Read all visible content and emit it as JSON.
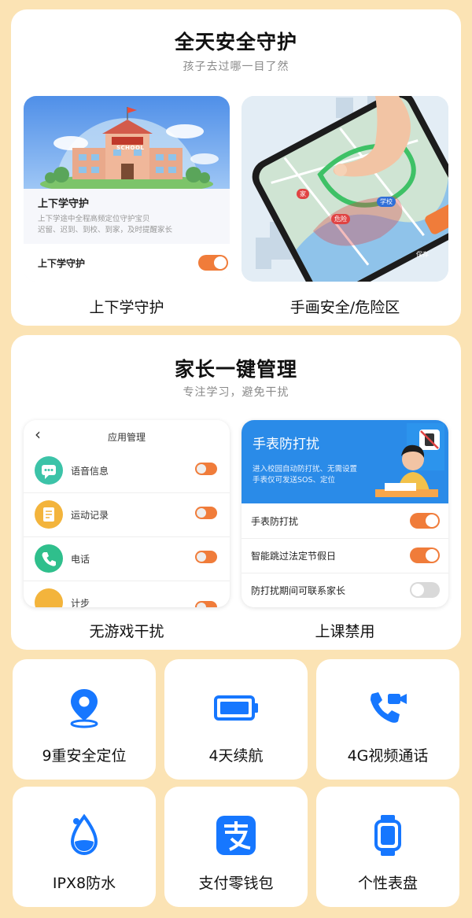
{
  "section1": {
    "title": "全天安全守护",
    "subtitle": "孩子去过哪一目了然",
    "card_left": {
      "school_sign": "SCHOOL",
      "heading": "上下学守护",
      "desc_line1": "上下学途中全程高频定位守护宝贝",
      "desc_line2": "迟留、迟到、到校、到家，及时提醒家长",
      "toggle_label": "上下学守护",
      "toggle_on": true
    },
    "card_right": {
      "map_tag1": "家",
      "map_tag2": "学校",
      "map_tag3": "危险",
      "button": "保存"
    },
    "caption_left": "上下学守护",
    "caption_right": "手画安全/危险区"
  },
  "section2": {
    "title": "家长一键管理",
    "subtitle": "专注学习，避免干扰",
    "app_mgmt": {
      "back": "‹",
      "title": "应用管理",
      "items": [
        {
          "label": "语音信息",
          "icon": "chat-icon",
          "color": "#3cc3a8",
          "on": true
        },
        {
          "label": "运动记录",
          "icon": "sport-record-icon",
          "color": "#f3b43c",
          "on": true
        },
        {
          "label": "电话",
          "icon": "phone-icon",
          "color": "#2fbf8c",
          "on": true
        },
        {
          "label": "计步",
          "icon": "steps-icon",
          "color": "#f3b43c",
          "on": true
        }
      ]
    },
    "dnd": {
      "banner_title": "手表防打扰",
      "banner_line1": "进入校园自动防打扰、无需设置",
      "banner_line2": "手表仅可发送SOS、定位",
      "rows": [
        {
          "label": "手表防打扰",
          "on": true
        },
        {
          "label": "智能跳过法定节假日",
          "on": true
        },
        {
          "label": "防打扰期间可联系家长",
          "on": false
        }
      ]
    },
    "caption_left": "无游戏干扰",
    "caption_right": "上课禁用"
  },
  "features": [
    {
      "label": "9重安全定位",
      "icon": "location-pin-icon"
    },
    {
      "label": "4天续航",
      "icon": "battery-icon"
    },
    {
      "label": "4G视频通话",
      "icon": "video-call-icon"
    },
    {
      "label": "IPX8防水",
      "icon": "water-drop-icon"
    },
    {
      "label": "支付零钱包",
      "icon": "alipay-icon"
    },
    {
      "label": "个性表盘",
      "icon": "watch-face-icon"
    }
  ],
  "colors": {
    "accent": "#1677ff",
    "toggle_on": "#f07c3a",
    "toggle_off": "#d9d9d9",
    "background": "#fbe3b4"
  }
}
